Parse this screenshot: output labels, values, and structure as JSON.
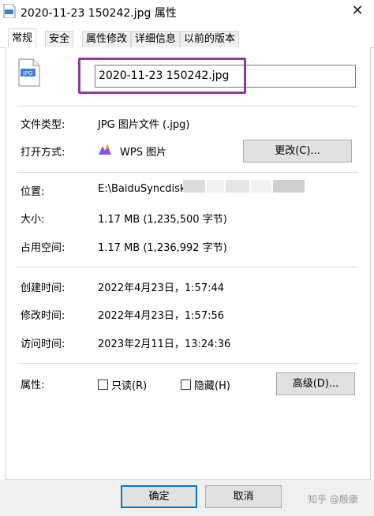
{
  "window": {
    "title": "2020-11-23  150242.jpg 属性",
    "close_glyph": "✕"
  },
  "tabs": [
    {
      "label": "常规",
      "active": true
    },
    {
      "label": "安全",
      "active": false
    },
    {
      "label": "属性修改",
      "active": false
    },
    {
      "label": "详细信息",
      "active": false
    },
    {
      "label": "以前的版本",
      "active": false
    }
  ],
  "file": {
    "icon_label": "JPG",
    "name": "2020-11-23  150242.jpg",
    "highlight_color": "#8e3b9d"
  },
  "details": {
    "file_type": {
      "label": "文件类型:",
      "value": "JPG 图片文件 (.jpg)"
    },
    "opens_with": {
      "label": "打开方式:",
      "value": "WPS 图片",
      "change_button": "更改(C)..."
    },
    "location": {
      "label": "位置:",
      "value": "E:\\BaiduSyncdisk\\"
    },
    "size": {
      "label": "大小:",
      "value": "1.17 MB (1,235,500 字节)"
    },
    "size_on_disk": {
      "label": "占用空间:",
      "value": "1.17 MB (1,236,992 字节)"
    },
    "created": {
      "label": "创建时间:",
      "value": "2022年4月23日，1:57:44"
    },
    "modified": {
      "label": "修改时间:",
      "value": "2022年4月23日，1:57:56"
    },
    "accessed": {
      "label": "访问时间:",
      "value": "2023年2月11日，13:24:36"
    }
  },
  "attributes": {
    "label": "属性:",
    "readonly": {
      "label": "只读(R)",
      "checked": false
    },
    "hidden": {
      "label": "隐藏(H)",
      "checked": false
    },
    "advanced_button": "高级(D)..."
  },
  "footer": {
    "ok_button": "确定",
    "cancel_button": "取消",
    "watermark": "知乎 @殷康"
  },
  "icons": {
    "file_icon": "jpg-file-icon",
    "app_icon": "jpg-file-icon",
    "wps_icon": "wps-picture-icon"
  }
}
